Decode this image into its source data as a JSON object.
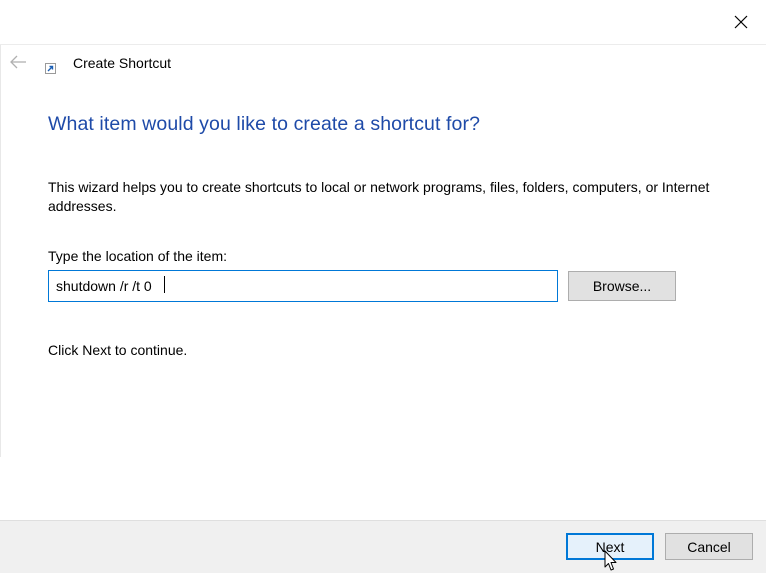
{
  "window": {
    "close_icon": "close-icon"
  },
  "header": {
    "back_icon": "back-arrow-icon",
    "app_icon": "shortcut-icon",
    "title": "Create Shortcut"
  },
  "main": {
    "heading": "What item would you like to create a shortcut for?",
    "description": "This wizard helps you to create shortcuts to local or network programs, files, folders, computers, or Internet addresses.",
    "location_label": "Type the location of the item:",
    "location_value": "shutdown /r /t 0",
    "browse_label": "Browse...",
    "continue_text": "Click Next to continue."
  },
  "footer": {
    "next_label": "Next",
    "cancel_label": "Cancel"
  },
  "colors": {
    "heading": "#1e4aa8",
    "focus_border": "#0078d7",
    "footer_bg": "#f0f0f0",
    "button_bg": "#e1e1e1"
  }
}
